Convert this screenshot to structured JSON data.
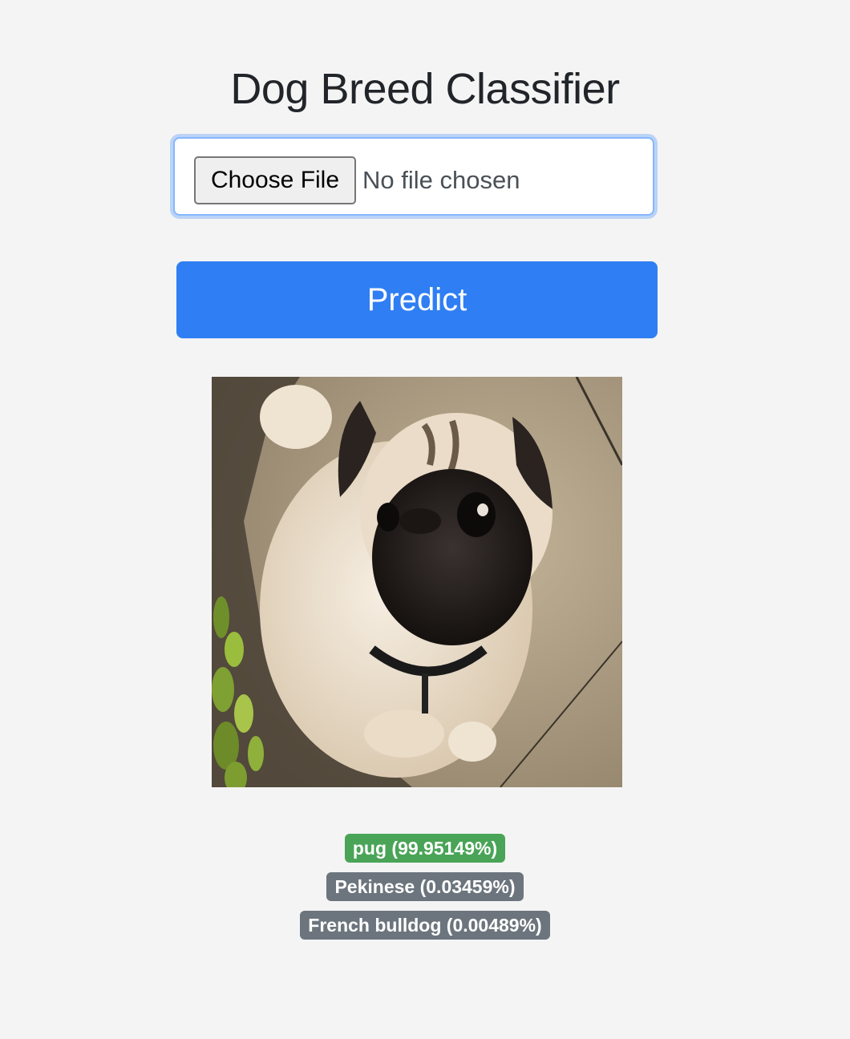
{
  "page": {
    "title": "Dog Breed Classifier"
  },
  "upload": {
    "button_label": "Choose File",
    "status_text": "No file chosen"
  },
  "actions": {
    "predict_label": "Predict"
  },
  "image": {
    "alt": "uploaded dog photo"
  },
  "predictions": [
    {
      "label": "pug (99.95149%)",
      "color": "#4aa457"
    },
    {
      "label": "Pekinese (0.03459%)",
      "color": "#6c757d"
    },
    {
      "label": "French bulldog (0.00489%)",
      "color": "#6c757d"
    }
  ],
  "colors": {
    "background": "#f4f4f4",
    "primary": "#2f7ef3",
    "success": "#4aa457",
    "secondary": "#6c757d",
    "focus_border": "#86b7fe"
  }
}
